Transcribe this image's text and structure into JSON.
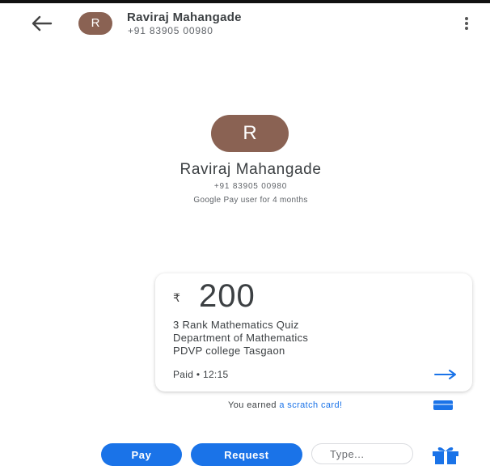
{
  "header": {
    "avatar_letter": "R",
    "name": "Raviraj Mahangade",
    "phone": "+91 83905 00980",
    "back_icon": "arrow-left-icon",
    "menu_icon": "more-vertical-icon"
  },
  "profile": {
    "avatar_letter": "R",
    "name": "Raviraj Mahangade",
    "phone": "+91 83905 00980",
    "since": "Google Pay user for 4 months"
  },
  "payment": {
    "currency": "₹",
    "amount": "200",
    "note_lines": [
      "3 Rank Mathematics Quiz",
      "Department of Mathematics",
      "PDVP college Tasgaon"
    ],
    "status": "Paid • 12:15",
    "arrow_icon": "arrow-right-icon"
  },
  "reward": {
    "prefix": "You earned ",
    "link": "a scratch card!",
    "icon": "scratch-card-icon"
  },
  "actions": {
    "pay_label": "Pay",
    "request_label": "Request",
    "type_placeholder": "Type...",
    "gift_icon": "gift-icon"
  },
  "colors": {
    "accent": "#1a73e8",
    "avatar": "#8a6253"
  }
}
